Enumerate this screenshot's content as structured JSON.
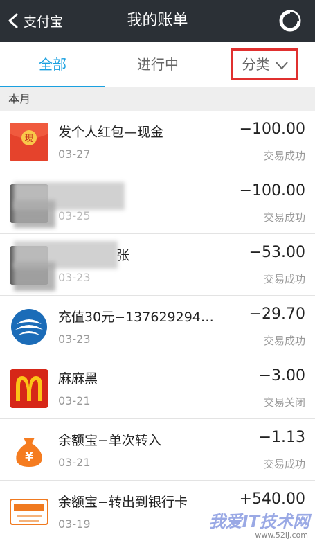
{
  "navbar": {
    "back_label": "支付宝",
    "title": "我的账单",
    "chart_icon": "pie-chart-icon"
  },
  "tabs": [
    {
      "label": "全部",
      "active": true
    },
    {
      "label": "进行中",
      "active": false
    },
    {
      "label": "分类",
      "active": false
    }
  ],
  "month_label": "本月",
  "transactions": [
    {
      "title": "发个人红包—现金",
      "date": "03-27",
      "amount": "−100.00",
      "status": "交易成功",
      "icon": "red-envelope-icon"
    },
    {
      "title": "",
      "date": "03-25",
      "amount": "−100.00",
      "status": "交易成功",
      "icon": "avatar-icon"
    },
    {
      "title": "张",
      "date": "03-23",
      "amount": "−53.00",
      "status": "交易成功",
      "icon": "avatar-icon"
    },
    {
      "title": "充值30元−137629294…",
      "date": "03-23",
      "amount": "−29.70",
      "status": "交易成功",
      "icon": "china-mobile-icon"
    },
    {
      "title": "麻麻黑",
      "date": "03-21",
      "amount": "−3.00",
      "status": "交易关闭",
      "icon": "mcdonalds-icon"
    },
    {
      "title": "余额宝−单次转入",
      "date": "03-21",
      "amount": "−1.13",
      "status": "交易成功",
      "icon": "yuebao-money-bag-icon"
    },
    {
      "title": "余额宝−转出到银行卡",
      "date": "03-19",
      "amount": "+540.00",
      "status": "",
      "icon": "ping-an-bank-icon"
    }
  ],
  "watermark": {
    "text": "我爱IT技术网",
    "url": "www.52ij.com"
  },
  "colors": {
    "navbar_bg": "#2b3036",
    "accent": "#1aa0e0",
    "highlight_box": "#e0302f"
  }
}
